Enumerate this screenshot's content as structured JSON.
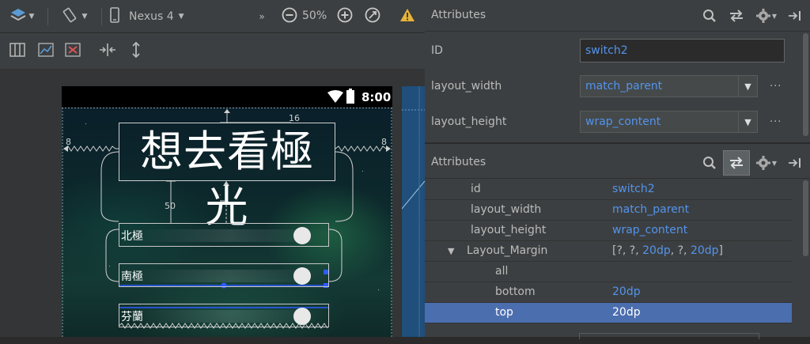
{
  "toolbar": {
    "device_label": "Nexus 4",
    "zoom_label": "50%",
    "more_label": "»"
  },
  "phone": {
    "clock": "8:00",
    "title": "想去看極光",
    "switches": [
      {
        "label": "北極"
      },
      {
        "label": "南極"
      },
      {
        "label": "芬蘭"
      }
    ],
    "dims": {
      "top_margin": "16",
      "left_margin": "8",
      "right_margin": "8",
      "spacing": "50"
    }
  },
  "panel_top": {
    "title": "Attributes",
    "id_label": "ID",
    "id_value": "switch2",
    "width_label": "layout_width",
    "width_value": "match_parent",
    "height_label": "layout_height",
    "height_value": "wrap_content",
    "more_dots": "···"
  },
  "panel_bottom": {
    "title": "Attributes",
    "rows": [
      {
        "name": "id",
        "value": "switch2"
      },
      {
        "name": "layout_width",
        "value": "match_parent"
      },
      {
        "name": "layout_height",
        "value": "wrap_content"
      },
      {
        "name": "Layout_Margin",
        "value_parts": [
          "[?, ?, ",
          "20dp",
          ", ?, ",
          "20dp",
          "]"
        ]
      },
      {
        "name": "all",
        "value": ""
      },
      {
        "name": "bottom",
        "value": "20dp"
      },
      {
        "name": "top",
        "value": "20dp"
      }
    ],
    "expand_glyph": "▼"
  },
  "colors": {
    "accent_value": "#5394ec",
    "selection": "#4b6eaf",
    "panel_bg": "#3c3f41"
  },
  "icons": [
    "layers-icon",
    "rotate-icon",
    "phone-icon",
    "zoom-out-icon",
    "zoom-in-icon",
    "zoom-fit-icon",
    "warning-icon",
    "search-icon",
    "swap-icon",
    "gear-icon",
    "pin-icon"
  ]
}
